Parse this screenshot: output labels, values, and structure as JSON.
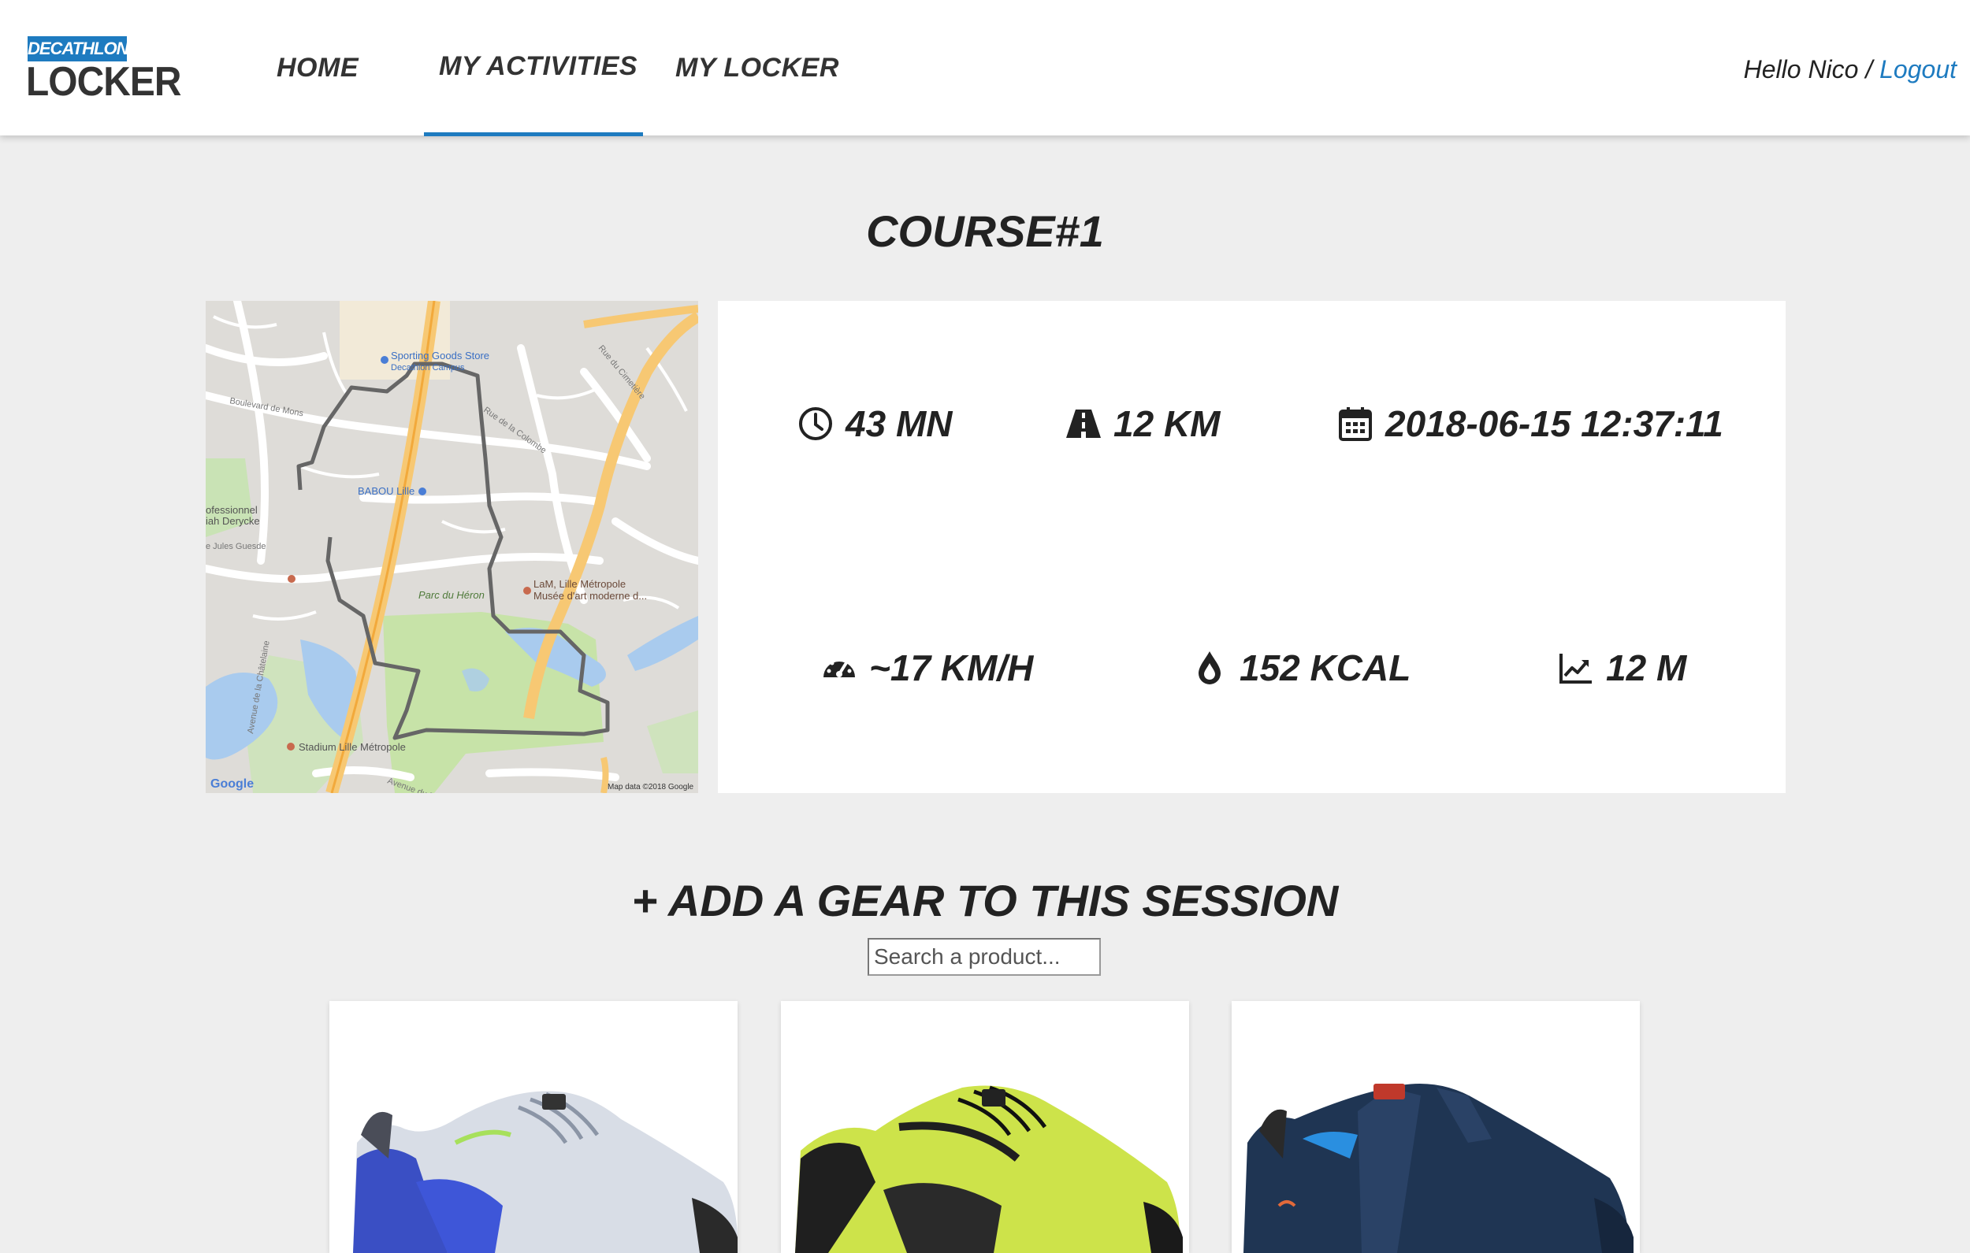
{
  "header": {
    "logo_badge": "DECATHLON",
    "logo_word": "LOCKER",
    "nav": [
      {
        "label": "HOME"
      },
      {
        "label": "MY ACTIVITIES",
        "active": true
      },
      {
        "label": "MY LOCKER"
      }
    ],
    "greeting": "Hello Nico",
    "separator": "/",
    "logout_label": "Logout"
  },
  "page_title": "COURSE#1",
  "map": {
    "labels": {
      "sporting_goods": "Sporting Goods Store",
      "decathlon_campus": "Decathlon Campus",
      "babou": "BABOU Lille",
      "parc": "Parc du Héron",
      "lam": "LaM, Lille Métropole",
      "lam2": "Musée d'art moderne d...",
      "stadium": "Stadium Lille Métropole",
      "professionnel": "ofessionnel",
      "derycke": "iah Derycke",
      "jules_guesde": "e Jules Guesde",
      "boulevard_mons": "Boulevard de Mons",
      "rue_cimetiere": "Rue du Cimetière",
      "rue_colombe": "Rue de la Colombe",
      "avenue_bois": "Avenue du Bois",
      "avenue_chatelaine": "Avenue de la Châtelaine",
      "google": "Google",
      "map_data": "Map data ©2018 Google"
    }
  },
  "stats": {
    "duration": "43 MN",
    "distance": "12 KM",
    "date": "2018-06-15 12:37:11",
    "speed": "~17 KM/H",
    "calories": "152 KCAL",
    "elevation": "12 M"
  },
  "icons": {
    "duration": "clock-icon",
    "distance": "road-icon",
    "date": "calendar-icon",
    "speed": "speedometer-icon",
    "calories": "drop-icon",
    "elevation": "line-chart-icon"
  },
  "colors": {
    "accent": "#1e7bc0",
    "background": "#eeeeee"
  },
  "add_gear": {
    "title": "+ ADD A GEAR TO THIS SESSION",
    "search_placeholder": "Search a product..."
  },
  "products": [
    {
      "name": "white-blue-running-shoe"
    },
    {
      "name": "yellow-black-running-shoe"
    },
    {
      "name": "navy-strap-shoe"
    }
  ]
}
